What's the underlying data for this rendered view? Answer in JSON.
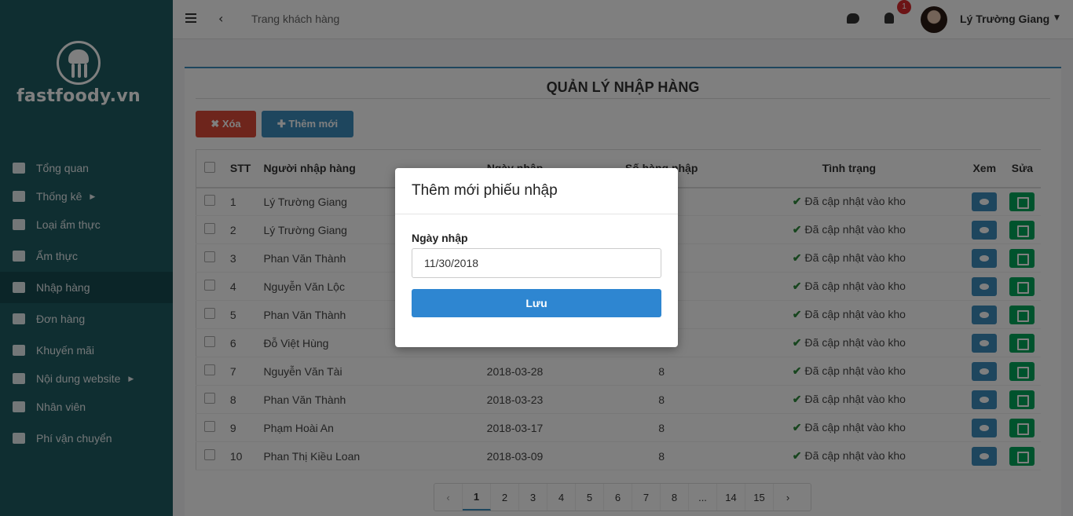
{
  "sidebar": {
    "logo_text": "fastfoody.vn",
    "items": [
      {
        "label": "Tổng quan",
        "icon": "dashboard-icon"
      },
      {
        "label": "Thống kê",
        "icon": "bar-chart-icon",
        "has_caret": true
      },
      {
        "label": "Loại ẩm thực",
        "icon": "sitemap-icon"
      },
      {
        "label": "Ẩm thực",
        "icon": "food-icon"
      },
      {
        "label": "Nhập hàng",
        "icon": "cart-icon",
        "active": true
      },
      {
        "label": "Đơn hàng",
        "icon": "clipboard-icon"
      },
      {
        "label": "Khuyến mãi",
        "icon": "percent-icon"
      },
      {
        "label": "Nội dung website",
        "icon": "list-icon",
        "has_caret": true
      },
      {
        "label": "Nhân viên",
        "icon": "users-icon"
      },
      {
        "label": "Phí vận chuyển",
        "icon": "truck-icon"
      }
    ]
  },
  "topbar": {
    "title": "Trang khách hàng",
    "notification_count": "1",
    "user_name": "Lý Trường Giang"
  },
  "main": {
    "title": "QUẢN LÝ NHẬP HÀNG",
    "delete_label": "✖ Xóa",
    "add_label": "✚ Thêm mới",
    "columns": [
      "STT",
      "Người nhập hàng",
      "Ngày nhập",
      "Số hàng nhập",
      "Tình trạng",
      "Xem",
      "Sửa"
    ],
    "rows": [
      {
        "stt": "1",
        "name": "Lý Trường Giang",
        "date": "",
        "qty": "",
        "status": "Đã cập nhật vào kho"
      },
      {
        "stt": "2",
        "name": "Lý Trường Giang",
        "date": "",
        "qty": "",
        "status": "Đã cập nhật vào kho"
      },
      {
        "stt": "3",
        "name": "Phan Văn Thành",
        "date": "",
        "qty": "",
        "status": "Đã cập nhật vào kho"
      },
      {
        "stt": "4",
        "name": "Nguyễn Văn Lộc",
        "date": "",
        "qty": "",
        "status": "Đã cập nhật vào kho"
      },
      {
        "stt": "5",
        "name": "Phan Văn Thành",
        "date": "",
        "qty": "",
        "status": "Đã cập nhật vào kho"
      },
      {
        "stt": "6",
        "name": "Đỗ Việt Hùng",
        "date": "",
        "qty": "",
        "status": "Đã cập nhật vào kho"
      },
      {
        "stt": "7",
        "name": "Nguyễn Văn Tài",
        "date": "2018-03-28",
        "qty": "8",
        "status": "Đã cập nhật vào kho"
      },
      {
        "stt": "8",
        "name": "Phan Văn Thành",
        "date": "2018-03-23",
        "qty": "8",
        "status": "Đã cập nhật vào kho"
      },
      {
        "stt": "9",
        "name": "Phạm Hoài An",
        "date": "2018-03-17",
        "qty": "8",
        "status": "Đã cập nhật vào kho"
      },
      {
        "stt": "10",
        "name": "Phan Thị Kiều Loan",
        "date": "2018-03-09",
        "qty": "8",
        "status": "Đã cập nhật vào kho"
      }
    ],
    "pagination": [
      "‹",
      "1",
      "2",
      "3",
      "4",
      "5",
      "6",
      "7",
      "8",
      "...",
      "14",
      "15",
      "›"
    ],
    "active_page": "1"
  },
  "modal": {
    "title": "Thêm mới phiếu nhập",
    "field_label": "Ngày nhập",
    "field_value": "11/30/2018",
    "save_label": "Lưu"
  },
  "colors": {
    "sidebar_bg": "#1f5c63",
    "primary": "#3c8dbc",
    "danger": "#dd4b39",
    "success": "#00a65a",
    "save_button": "#2e86d1"
  }
}
